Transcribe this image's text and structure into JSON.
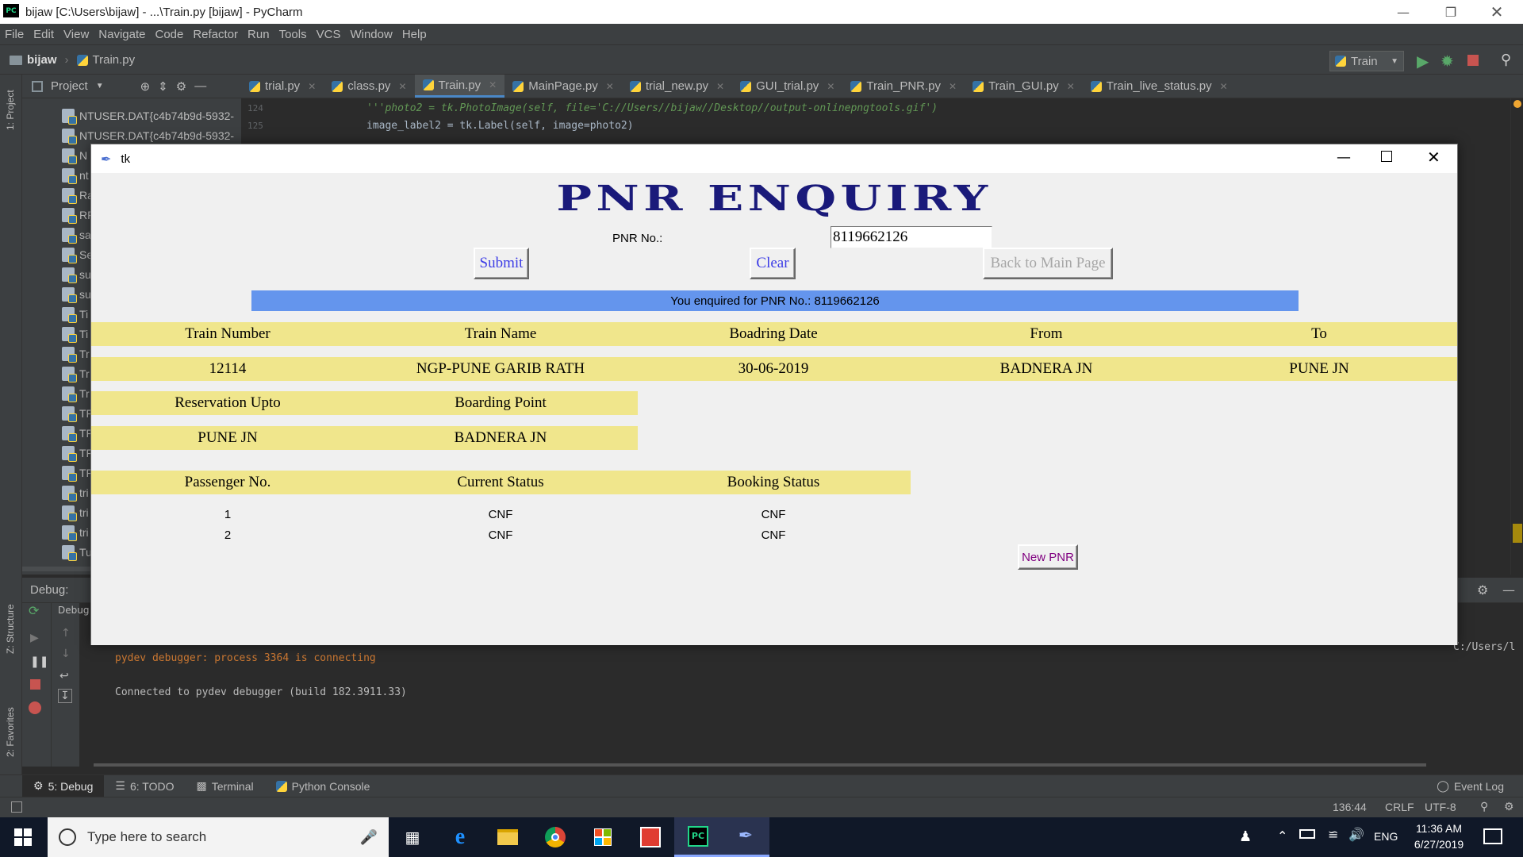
{
  "pycharm": {
    "window_title": "bijaw [C:\\Users\\bijaw] - ...\\Train.py [bijaw] - PyCharm",
    "logo": "PC",
    "menu": [
      "File",
      "Edit",
      "View",
      "Navigate",
      "Code",
      "Refactor",
      "Run",
      "Tools",
      "VCS",
      "Window",
      "Help"
    ],
    "breadcrumb": {
      "project": "bijaw",
      "file": "Train.py"
    },
    "run_config": "Train",
    "project_panel": {
      "title": "Project",
      "items": [
        "NTUSER.DAT{c4b74b9d-5932-",
        "NTUSER.DAT{c4b74b9d-5932-",
        "N",
        "nt",
        "Ra",
        "RF",
        "sa",
        "Se",
        "su",
        "su",
        "Ti",
        "Ti",
        "Tr",
        "Tr",
        "Tr",
        "TF",
        "TF",
        "TF",
        "TF",
        "tri",
        "tri",
        "tri",
        "Tu"
      ]
    },
    "editor_tabs": [
      {
        "label": "trial.py"
      },
      {
        "label": "class.py"
      },
      {
        "label": "Train.py",
        "active": true
      },
      {
        "label": "MainPage.py"
      },
      {
        "label": "trial_new.py"
      },
      {
        "label": "GUI_trial.py"
      },
      {
        "label": "Train_PNR.py"
      },
      {
        "label": "Train_GUI.py"
      },
      {
        "label": "Train_live_status.py"
      }
    ],
    "editor_lines": [
      {
        "num": "124",
        "text": "'''photo2 = tk.PhotoImage(self, file='C://Users//bijaw//Desktop//output-onlinepngtools.gif')"
      },
      {
        "num": "125",
        "text": "image_label2 = tk.Label(self, image=photo2)"
      }
    ],
    "left_stripe": {
      "project": "1: Project",
      "structure": "Z: Structure",
      "favorites": "2: Favorites"
    },
    "debug": {
      "label": "Debug:",
      "tab": "Debug",
      "console": [
        {
          "text": "pydev debugger: process 3364 is connecting",
          "color": "#cc7832"
        },
        {
          "text": "Connected to pydev debugger (build 182.3911.33)",
          "color": "#bbbbbb"
        }
      ],
      "cut_path": "C:/Users/l"
    },
    "bottom_tabs": [
      {
        "label": "5: Debug",
        "active": true
      },
      {
        "label": "6: TODO"
      },
      {
        "label": "Terminal"
      },
      {
        "label": "Python Console"
      }
    ],
    "event_log": "Event Log",
    "status": {
      "position": "136:44",
      "line_sep": "CRLF",
      "encoding": "UTF-8"
    }
  },
  "tk": {
    "title": "tk",
    "heading": "PNR ENQUIRY",
    "pnr_label": "PNR No.:",
    "pnr_value": "8119662126",
    "buttons": {
      "submit": "Submit",
      "clear": "Clear",
      "back": "Back to Main Page",
      "new_pnr": "New PNR"
    },
    "enquiry_banner": "You enquired for PNR No.: 8119662126",
    "train_table": {
      "headers": [
        "Train Number",
        "Train Name",
        "Boadring Date",
        "From",
        "To"
      ],
      "row": [
        "12114",
        "NGP-PUNE GARIB RATH",
        "30-06-2019",
        "BADNERA JN",
        "PUNE JN"
      ]
    },
    "reservation_table": {
      "headers": [
        "Reservation Upto",
        "Boarding Point"
      ],
      "row": [
        "PUNE JN",
        "BADNERA JN"
      ]
    },
    "passenger_table": {
      "headers": [
        "Passenger No.",
        "Current Status",
        "Booking Status"
      ],
      "rows": [
        [
          "1",
          "CNF",
          "CNF"
        ],
        [
          "2",
          "CNF",
          "CNF"
        ]
      ]
    }
  },
  "taskbar": {
    "search_placeholder": "Type here to search",
    "language": "ENG",
    "time": "11:36 AM",
    "date": "6/27/2019"
  },
  "colors": {
    "ide_bg": "#2b2b2b",
    "panel": "#3c3f41",
    "banner": "#6495ed",
    "row_highlight": "#f0e68c",
    "heading": "#1a1a7a"
  }
}
